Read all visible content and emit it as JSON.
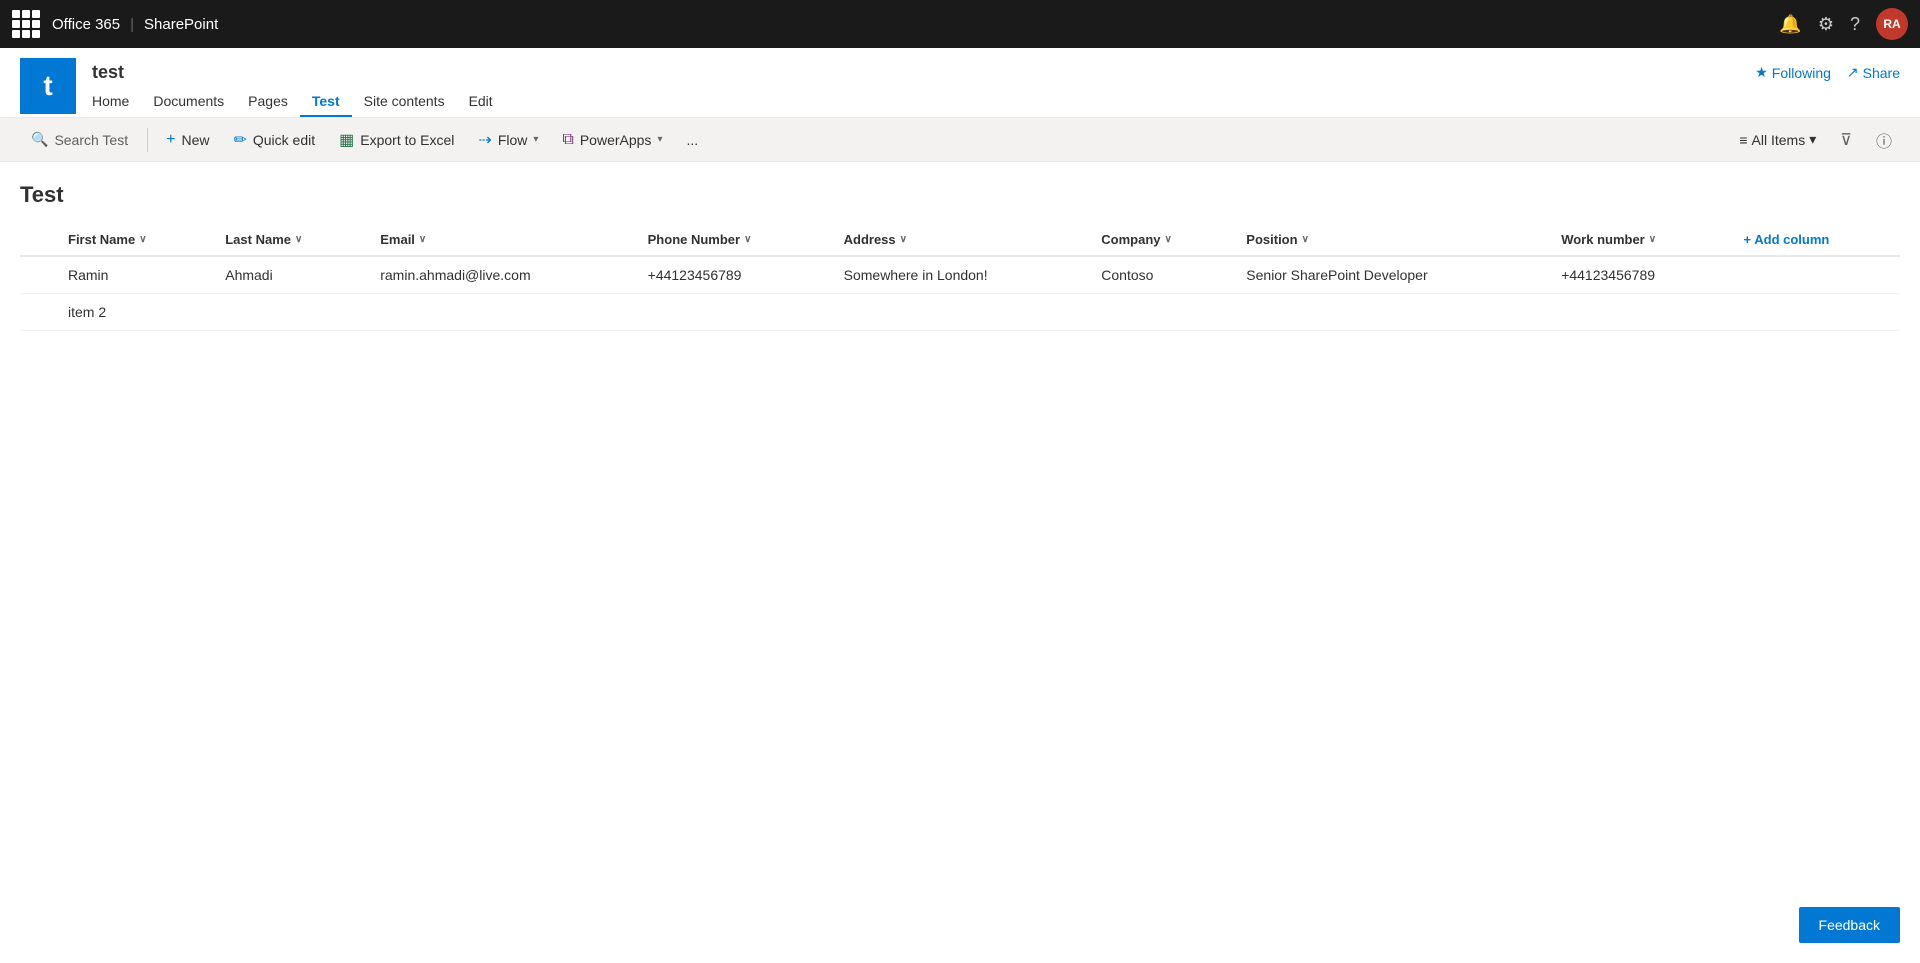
{
  "topbar": {
    "office365": "Office 365",
    "divider": "|",
    "sharepoint": "SharePoint",
    "notifications_icon": "🔔",
    "settings_icon": "⚙",
    "help_icon": "?",
    "avatar_label": "RA"
  },
  "site": {
    "logo_letter": "t",
    "name": "test",
    "nav": [
      {
        "label": "Home",
        "active": false
      },
      {
        "label": "Documents",
        "active": false
      },
      {
        "label": "Pages",
        "active": false
      },
      {
        "label": "Test",
        "active": true
      },
      {
        "label": "Site contents",
        "active": false
      },
      {
        "label": "Edit",
        "active": false
      }
    ],
    "following_label": "Following",
    "share_label": "Share"
  },
  "commandbar": {
    "search_placeholder": "Search Test",
    "new_label": "New",
    "quickedit_label": "Quick edit",
    "export_label": "Export to Excel",
    "flow_label": "Flow",
    "powerapps_label": "PowerApps",
    "more_label": "...",
    "view_label": "All Items",
    "filter_icon": "filter"
  },
  "list": {
    "title": "Test",
    "columns": [
      {
        "label": "First Name",
        "sortable": true
      },
      {
        "label": "Last Name",
        "sortable": true
      },
      {
        "label": "Email",
        "sortable": true
      },
      {
        "label": "Phone Number",
        "sortable": true
      },
      {
        "label": "Address",
        "sortable": true
      },
      {
        "label": "Company",
        "sortable": true
      },
      {
        "label": "Position",
        "sortable": true
      },
      {
        "label": "Work number",
        "sortable": true
      }
    ],
    "add_column_label": "+ Add column",
    "rows": [
      {
        "first_name": "Ramin",
        "last_name": "Ahmadi",
        "email": "ramin.ahmadi@live.com",
        "phone": "+44123456789",
        "address": "Somewhere in London!",
        "company": "Contoso",
        "position": "Senior SharePoint Developer",
        "work_number": "+44123456789"
      },
      {
        "first_name": "item 2",
        "last_name": "",
        "email": "",
        "phone": "",
        "address": "",
        "company": "",
        "position": "",
        "work_number": ""
      }
    ]
  },
  "feedback": {
    "label": "Feedback"
  }
}
